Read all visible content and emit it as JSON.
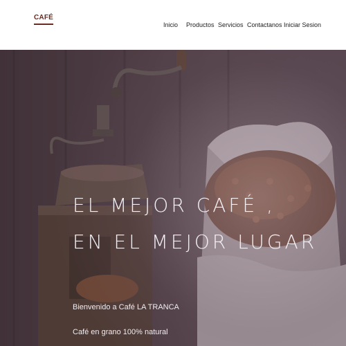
{
  "header": {
    "logo_text": "CAFÉ",
    "nav": {
      "inicio": "Inicio",
      "productos": "Productos",
      "servicios": "Servicios",
      "contactanos": "Contactanos",
      "iniciar_sesion": "Iniciar Sesion"
    }
  },
  "hero": {
    "headline_line1": "EL MEJOR CAFÉ ,",
    "headline_line2": "EN EL MEJOR LUGAR",
    "welcome": "Bienvenido a Café LA TRANCA",
    "tagline": "Café en grano 100% natural"
  },
  "colors": {
    "brand": "#6b2a22",
    "hero_text": "#f2eef2",
    "nav_text": "#222222"
  },
  "icons": {
    "logo": "coffee-logo",
    "grinder": "coffee-grinder-illustration",
    "sack": "coffee-sack-illustration"
  }
}
